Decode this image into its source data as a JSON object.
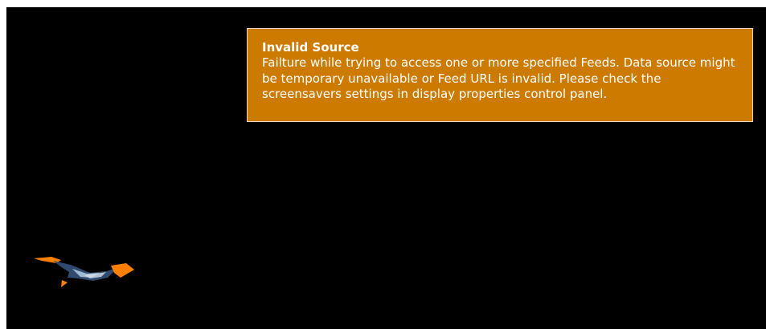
{
  "screen": {
    "background": "#000000"
  },
  "alert": {
    "title": "Invalid Source",
    "message": "Failture while trying to access one or more specified Feeds. Data source might be temporary unavailable or Feed URL is invalid. Please check the screensavers settings in display properties control panel.",
    "background": "#cc7a00",
    "border_color": "#f0d9b8"
  },
  "logo": {
    "icon": "bird-logo-icon",
    "primary_color": "#ff7f00",
    "secondary_color": "#2f4a6d"
  }
}
